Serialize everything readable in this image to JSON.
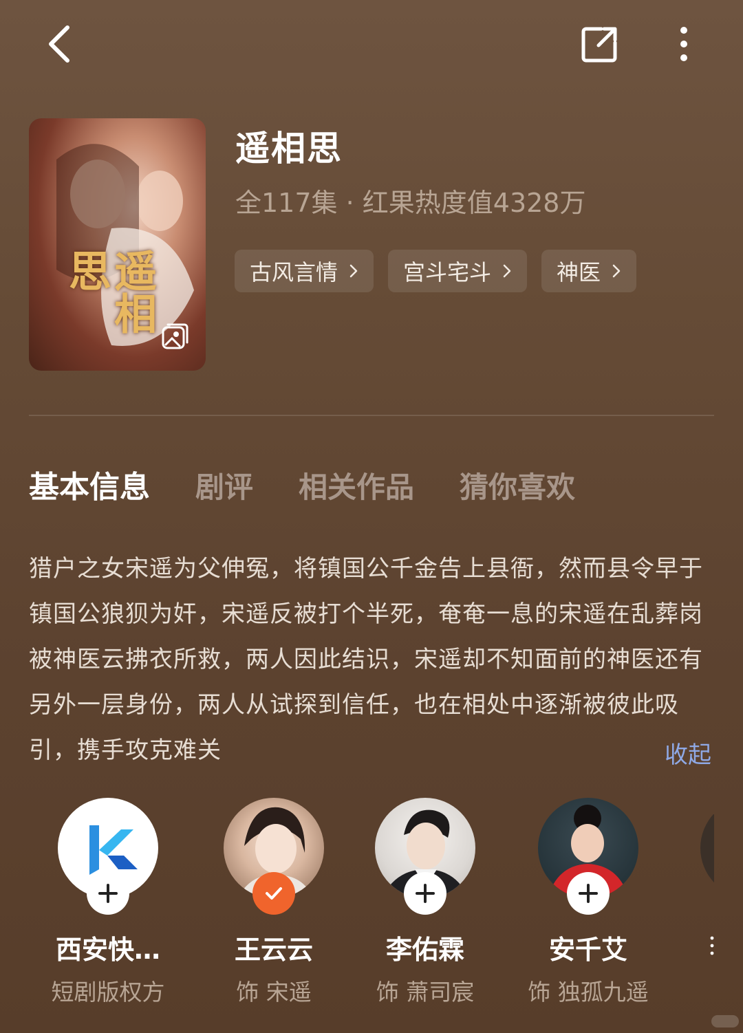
{
  "topbar": {
    "back_icon": "chevron-left-icon",
    "share_icon": "share-icon",
    "more_icon": "more-vertical-icon"
  },
  "show": {
    "title": "遥相思",
    "meta": "全117集 · 红果热度值4328万",
    "poster_title": "遥相思",
    "tags": [
      {
        "label": "古风言情"
      },
      {
        "label": "宫斗宅斗"
      },
      {
        "label": "神医"
      }
    ]
  },
  "tabs": [
    {
      "label": "基本信息",
      "active": true
    },
    {
      "label": "剧评"
    },
    {
      "label": "相关作品"
    },
    {
      "label": "猜你喜欢"
    }
  ],
  "synopsis": {
    "text": "猎户之女宋遥为父伸冤，将镇国公千金告上县衙，然而县令早于镇国公狼狈为奸，宋遥反被打个半死，奄奄一息的宋遥在乱葬岗被神医云拂衣所救，两人因此结识，宋遥却不知面前的神医还有另外一层身份，两人从试探到信任，也在相处中逐渐被彼此吸引，携手攻克难关",
    "collapse_label": "收起"
  },
  "cast": [
    {
      "name": "西安快…",
      "role": "短剧版权方",
      "followed": false,
      "avatar": "logo-k"
    },
    {
      "name": "王云云",
      "role": "饰 宋遥",
      "followed": true
    },
    {
      "name": "李佑霖",
      "role": "饰 萧司宸",
      "followed": false
    },
    {
      "name": "安千艾",
      "role": "饰 独孤九遥",
      "followed": false
    }
  ],
  "colors": {
    "accent_orange": "#f0642c",
    "link_blue": "#8fa9e6"
  }
}
